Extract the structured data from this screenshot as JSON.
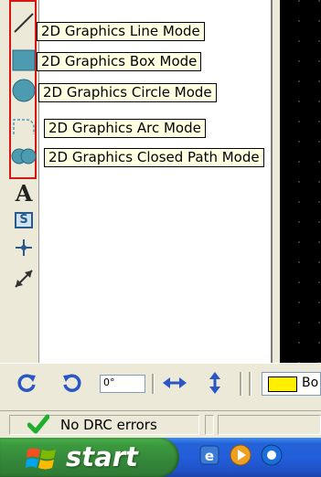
{
  "tools": [
    {
      "name": "line-tool",
      "icon": "line-icon",
      "tooltip": "2D Graphics Line Mode"
    },
    {
      "name": "box-tool",
      "icon": "box-icon",
      "tooltip": "2D Graphics Box Mode"
    },
    {
      "name": "circle-tool",
      "icon": "circle-icon",
      "tooltip": "2D Graphics Circle Mode"
    },
    {
      "name": "arc-tool",
      "icon": "arc-icon",
      "tooltip": "2D Graphics Arc Mode"
    },
    {
      "name": "closed-path-tool",
      "icon": "closed-path-icon",
      "tooltip": "2D Graphics Closed Path Mode"
    },
    {
      "name": "text-tool",
      "icon": "text-icon",
      "label": "A"
    },
    {
      "name": "symbol-tool",
      "icon": "symbol-icon",
      "label": "S"
    },
    {
      "name": "origin-tool",
      "icon": "crosshair-icon"
    },
    {
      "name": "dimension-tool",
      "icon": "dimension-arrow-icon"
    }
  ],
  "bottom_toolbar": {
    "rotate_cw_icon": "rotate-clockwise-icon",
    "rotate_ccw_icon": "rotate-counterclockwise-icon",
    "angle_value": "0°",
    "flip_horizontal_icon": "flip-horizontal-icon",
    "flip_vertical_icon": "flip-vertical-icon",
    "layer_label": "Bo",
    "layer_color": "#ffef00"
  },
  "status": {
    "check_icon": "checkmark-icon",
    "drc_text": "No DRC errors"
  },
  "taskbar": {
    "start_label": "start",
    "quick_launch": [
      "ie-icon",
      "media-player-icon",
      "app-icon"
    ]
  },
  "colors": {
    "highlight_border": "#d81414",
    "tooltip_bg": "#ffffe1",
    "taskbar_blue": "#245edb",
    "start_green": "#3c9a3e",
    "check_green": "#1fae2e"
  }
}
